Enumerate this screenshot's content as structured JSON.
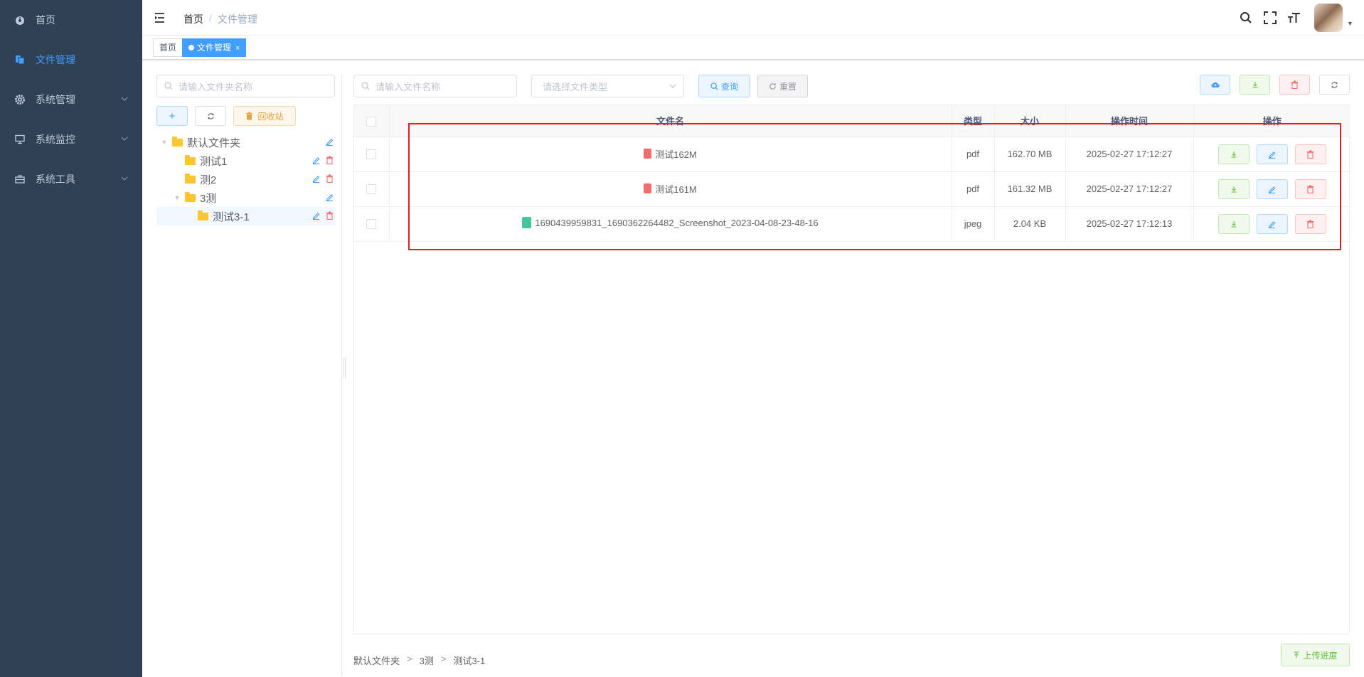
{
  "sidebar": {
    "items": [
      {
        "label": "首页",
        "icon": "dashboard-icon",
        "active": false
      },
      {
        "label": "文件管理",
        "icon": "file-manage-icon",
        "active": true
      },
      {
        "label": "系统管理",
        "icon": "gear-icon",
        "active": false
      },
      {
        "label": "系统监控",
        "icon": "monitor-icon",
        "active": false
      },
      {
        "label": "系统工具",
        "icon": "toolbox-icon",
        "active": false
      }
    ]
  },
  "navbar": {
    "breadcrumb": {
      "home": "首页",
      "separator": "/",
      "current": "文件管理"
    }
  },
  "tags": {
    "home": "首页",
    "active": "文件管理",
    "close": "×"
  },
  "folder_panel": {
    "search_placeholder": "请输入文件夹名称",
    "recycle_label": "回收站",
    "add_label": "+",
    "tree": [
      {
        "label": "默认文件夹",
        "level": 0,
        "expanded": true
      },
      {
        "label": "测试1",
        "level": 1
      },
      {
        "label": "测2",
        "level": 1
      },
      {
        "label": "3测",
        "level": 1,
        "expanded": true
      },
      {
        "label": "测试3-1",
        "level": 2,
        "selected": true
      }
    ]
  },
  "file_panel": {
    "name_placeholder": "请输入文件名称",
    "type_placeholder": "请选择文件类型",
    "query_label": "查询",
    "reset_label": "重置",
    "columns": [
      "文件名",
      "类型",
      "大小",
      "操作时间",
      "操作"
    ],
    "rows": [
      {
        "name": "测试162M",
        "type": "pdf",
        "size": "162.70 MB",
        "time": "2025-02-27 17:12:27",
        "icon": "pdf-file-icon"
      },
      {
        "name": "测试161M",
        "type": "pdf",
        "size": "161.32 MB",
        "time": "2025-02-27 17:12:27",
        "icon": "pdf-file-icon"
      },
      {
        "name": "1690439959831_1690362264482_Screenshot_2023-04-08-23-48-16",
        "type": "jpeg",
        "size": "2.04 KB",
        "time": "2025-02-27 17:12:13",
        "icon": "image-file-icon"
      }
    ],
    "path": [
      "默认文件夹",
      "3测",
      "测试3-1"
    ],
    "path_separator": ">",
    "upload_progress_label": "上传进度"
  },
  "colors": {
    "sidebar_bg": "#304156",
    "accent": "#409eff",
    "success": "#67c23a",
    "danger": "#f56c6c",
    "warning": "#e6a23c",
    "highlight": "#e02020"
  }
}
